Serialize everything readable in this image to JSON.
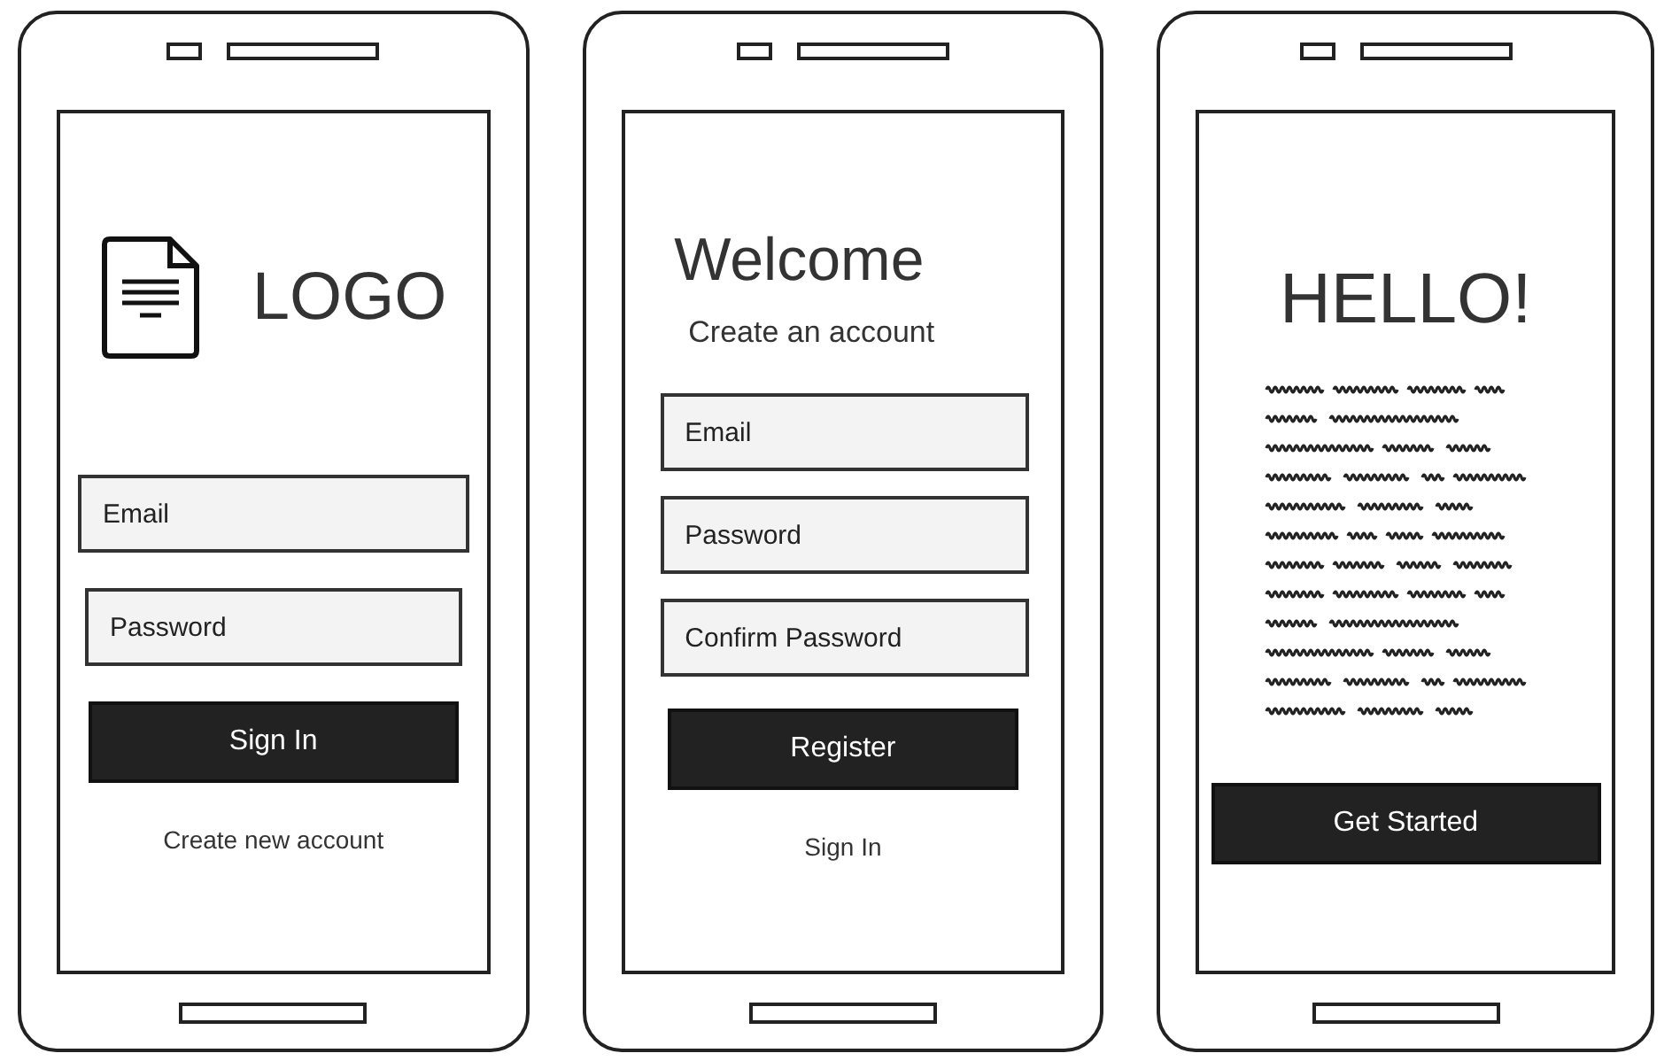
{
  "screens": [
    {
      "kind": "login",
      "logo": "LOGO",
      "fields": [
        {
          "placeholder": "Email"
        },
        {
          "placeholder": "Password"
        }
      ],
      "button": "Sign In",
      "link": "Create new account"
    },
    {
      "kind": "register",
      "title": "Welcome",
      "subtitle": "Create an account",
      "fields": [
        {
          "placeholder": "Email"
        },
        {
          "placeholder": "Password"
        },
        {
          "placeholder": "Confirm Password"
        }
      ],
      "button": "Register",
      "link": "Sign In"
    },
    {
      "kind": "intro",
      "title": "HELLO!",
      "button": "Get Started"
    }
  ]
}
